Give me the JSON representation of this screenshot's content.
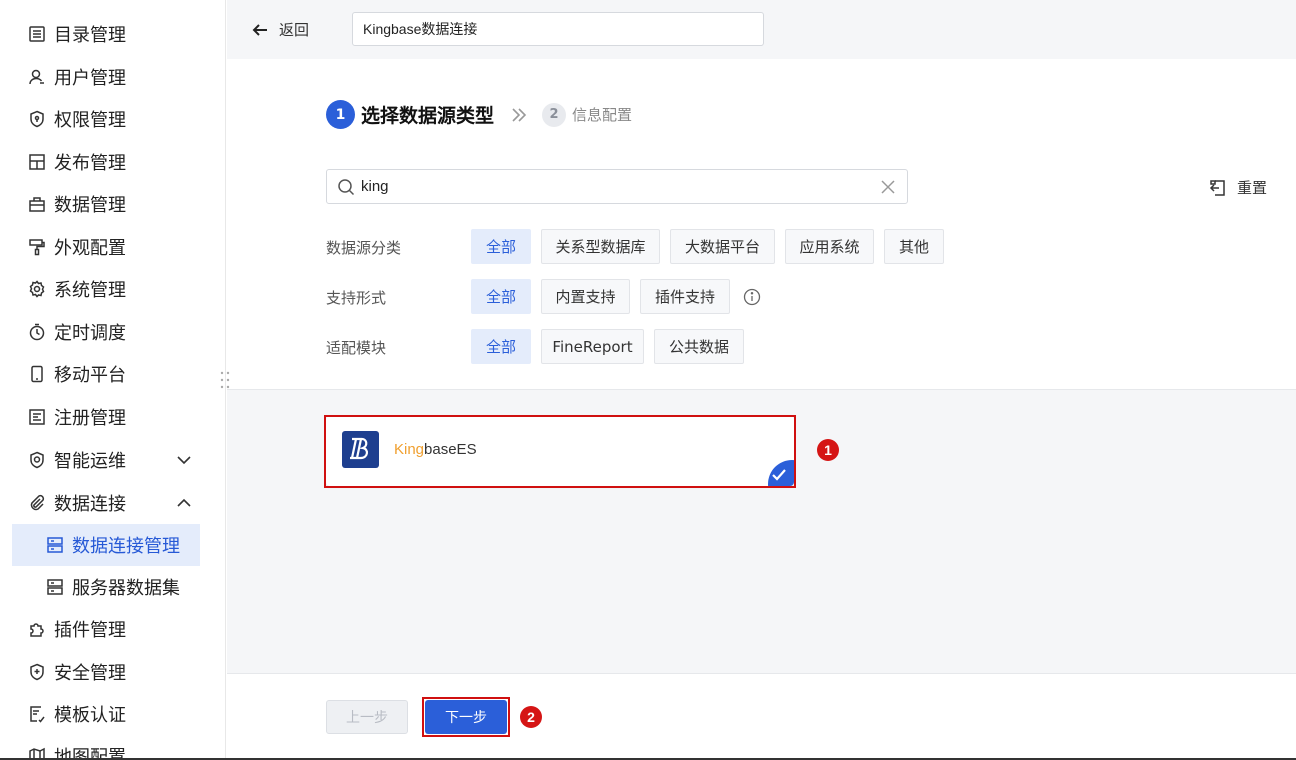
{
  "sidebar": {
    "items": [
      {
        "label": "目录管理",
        "icon": "list-icon"
      },
      {
        "label": "用户管理",
        "icon": "user-icon"
      },
      {
        "label": "权限管理",
        "icon": "shield-lock-icon"
      },
      {
        "label": "发布管理",
        "icon": "layout-icon"
      },
      {
        "label": "数据管理",
        "icon": "database-box-icon"
      },
      {
        "label": "外观配置",
        "icon": "paint-roller-icon"
      },
      {
        "label": "系统管理",
        "icon": "gear-icon"
      },
      {
        "label": "定时调度",
        "icon": "stopwatch-icon"
      },
      {
        "label": "移动平台",
        "icon": "mobile-icon"
      },
      {
        "label": "注册管理",
        "icon": "register-icon"
      },
      {
        "label": "智能运维",
        "icon": "ops-icon"
      },
      {
        "label": "数据连接",
        "icon": "paperclip-icon"
      },
      {
        "label": "数据连接管理",
        "icon": "server-icon"
      },
      {
        "label": "服务器数据集",
        "icon": "server-icon"
      },
      {
        "label": "插件管理",
        "icon": "puzzle-icon"
      },
      {
        "label": "安全管理",
        "icon": "shield-plus-icon"
      },
      {
        "label": "模板认证",
        "icon": "certificate-icon"
      },
      {
        "label": "地图配置",
        "icon": "map-icon"
      }
    ]
  },
  "header": {
    "back_label": "返回",
    "name_value": "Kingbase数据连接"
  },
  "steps": {
    "step1_num": "1",
    "step1_label": "选择数据源类型",
    "step2_num": "2",
    "step2_label": "信息配置"
  },
  "search": {
    "value": "king",
    "reset_label": "重置"
  },
  "filters": {
    "category_label": "数据源分类",
    "category_options": [
      "全部",
      "关系型数据库",
      "大数据平台",
      "应用系统",
      "其他"
    ],
    "support_label": "支持形式",
    "support_options": [
      "全部",
      "内置支持",
      "插件支持"
    ],
    "module_label": "适配模块",
    "module_options": [
      "全部",
      "FineReport",
      "公共数据"
    ]
  },
  "result": {
    "name_highlight": "King",
    "name_rest": "baseES",
    "selected": true
  },
  "annotations": {
    "badge1": "1",
    "badge2": "2"
  },
  "footer": {
    "prev_label": "上一步",
    "next_label": "下一步"
  },
  "colors": {
    "accent": "#2b5fd9",
    "highlight": "#f0a030",
    "annotation": "#d01010"
  }
}
